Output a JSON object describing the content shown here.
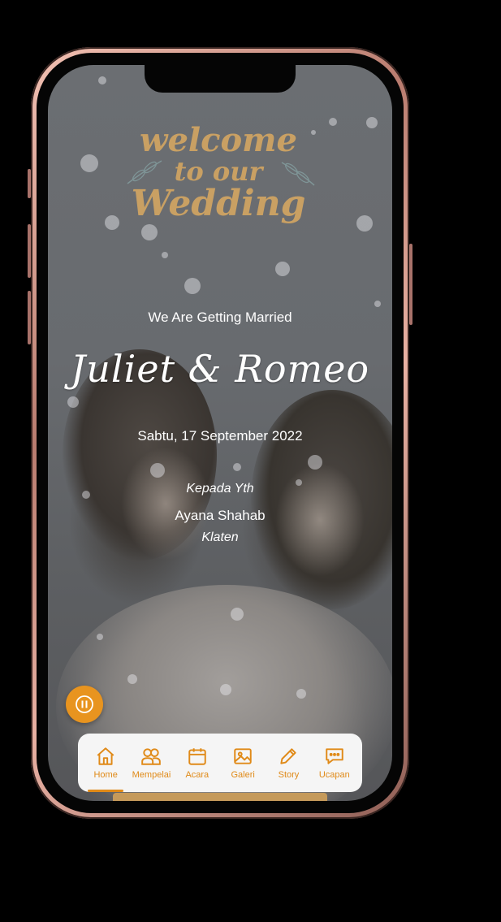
{
  "header": {
    "welcome_line1": "welcome",
    "welcome_line2": "to our",
    "welcome_line3": "Wedding"
  },
  "hero": {
    "subtitle": "We Are Getting Married",
    "couple_names": "Juliet & Romeo",
    "date": "Sabtu, 17 September 2022"
  },
  "invitation": {
    "salutation": "Kepada Yth",
    "guest_name": "Ayana Shahab",
    "guest_city": "Klaten"
  },
  "music_button": {
    "icon": "pause-icon"
  },
  "nav": {
    "items": [
      {
        "label": "Home",
        "icon": "home-icon",
        "active": true
      },
      {
        "label": "Mempelai",
        "icon": "couple-icon",
        "active": false
      },
      {
        "label": "Acara",
        "icon": "calendar-icon",
        "active": false
      },
      {
        "label": "Galeri",
        "icon": "image-icon",
        "active": false
      },
      {
        "label": "Story",
        "icon": "pencil-icon",
        "active": false
      },
      {
        "label": "Ucapan",
        "icon": "chat-icon",
        "active": false
      }
    ]
  },
  "colors": {
    "accent": "#e08a18",
    "gold": "#c9a063",
    "frame": "#c98f82"
  }
}
